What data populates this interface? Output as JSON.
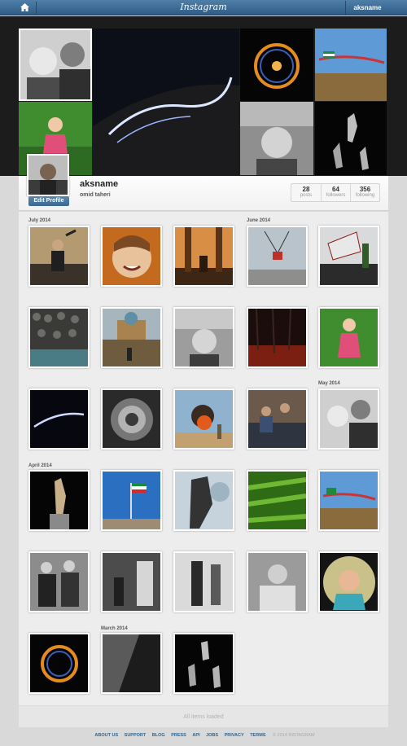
{
  "nav": {
    "logo": "Instagram",
    "username": "aksname",
    "home_icon": "home-icon"
  },
  "profile": {
    "username": "aksname",
    "full_name": "omid taheri",
    "edit_label": "Edit Profile",
    "counts": [
      {
        "value": "28",
        "label": "posts"
      },
      {
        "value": "64",
        "label": "followers"
      },
      {
        "value": "356",
        "label": "following"
      }
    ]
  },
  "months": {
    "july": "July 2014",
    "june": "June 2014",
    "may": "May 2014",
    "april": "April 2014",
    "march": "March 2014"
  },
  "feed": {
    "status": "All items loaded"
  },
  "footer": {
    "links": [
      "ABOUT US",
      "SUPPORT",
      "BLOG",
      "PRESS",
      "API",
      "JOBS",
      "PRIVACY",
      "TERMS"
    ],
    "copyright": "© 2014 INSTAGRAM"
  },
  "colors": {
    "nav": "#3a6790",
    "accent": "#2f6592"
  }
}
